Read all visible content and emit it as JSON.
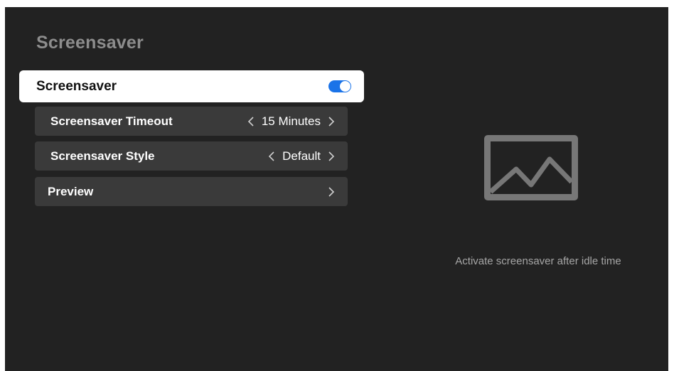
{
  "page": {
    "title": "Screensaver"
  },
  "settings": {
    "screensaver": {
      "label": "Screensaver",
      "enabled": true,
      "accent": "#1a73e8"
    },
    "timeout": {
      "label": "Screensaver Timeout",
      "value": "15 Minutes"
    },
    "style": {
      "label": "Screensaver Style",
      "value": "Default"
    },
    "preview": {
      "label": "Preview"
    }
  },
  "info_panel": {
    "icon": "image-placeholder-icon",
    "description": "Activate screensaver after idle time"
  }
}
